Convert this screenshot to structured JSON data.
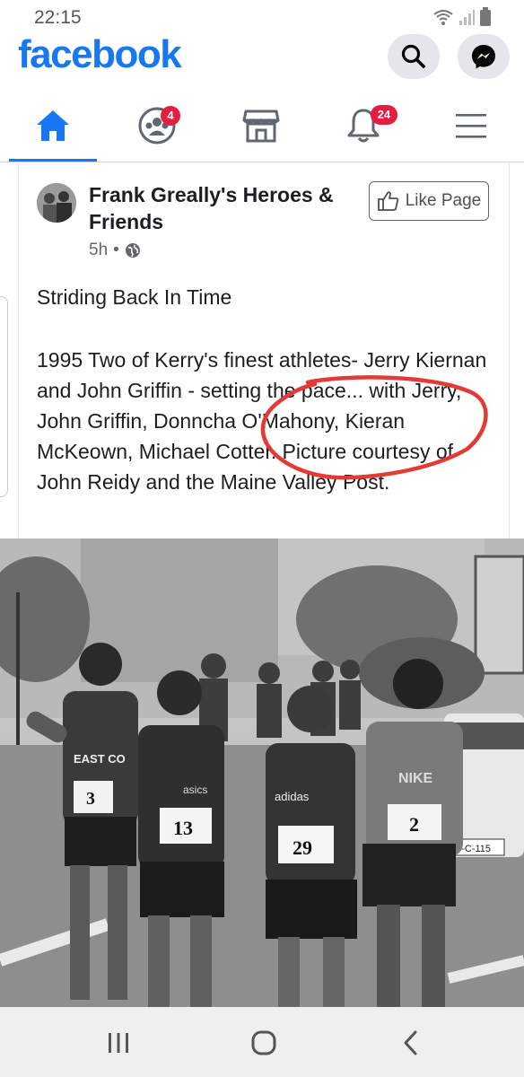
{
  "status": {
    "time": "22:15"
  },
  "header": {
    "brand": "facebook",
    "search_icon": "search-icon",
    "messenger_icon": "messenger-icon"
  },
  "nav": {
    "items": [
      {
        "name": "home",
        "icon": "home-icon",
        "active": true
      },
      {
        "name": "groups",
        "icon": "groups-icon",
        "badge": "4"
      },
      {
        "name": "marketplace",
        "icon": "marketplace-icon"
      },
      {
        "name": "notifications",
        "icon": "bell-icon",
        "badge": "24"
      },
      {
        "name": "menu",
        "icon": "hamburger-icon"
      }
    ]
  },
  "post": {
    "page_name": "Frank Greally's Heroes & Friends",
    "time": "5h",
    "separator": "•",
    "like_page_label": "Like Page",
    "title": "Striding Back In Time",
    "body": "1995 Two of Kerry's finest athletes- Jerry Kiernan and John Griffin - setting the pace... with Jerry, John Griffin, Donncha O'Mahony, Kieran McKeown, Michael Cotter. Picture courtesy of John Reidy and the Maine Valley Post.",
    "photo": {
      "bibs": [
        "3",
        "13",
        "29",
        "2"
      ],
      "vest_text": [
        "EAST CO",
        "asics",
        "adidas",
        "NIKE"
      ],
      "plate": "87-C-115"
    }
  },
  "colors": {
    "brand": "#1877f2",
    "badge": "#e41e3f",
    "annotation": "#e53935"
  }
}
